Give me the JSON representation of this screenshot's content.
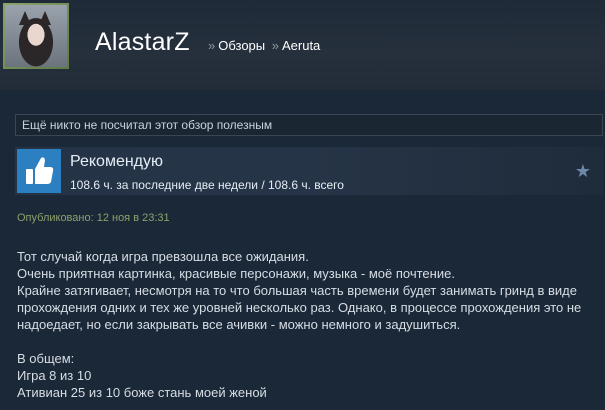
{
  "header": {
    "profile_name": "AlastarZ",
    "breadcrumb_sep": "»",
    "breadcrumb": [
      "Обзоры",
      "Aeruta"
    ]
  },
  "review": {
    "helpful_text": "Ещё никто не посчитал этот обзор полезным",
    "recommendation": "Рекомендую",
    "hours": "108.6 ч. за последние две недели / 108.6 ч. всего",
    "posted": "Опубликовано: 12 ноя в 23:31",
    "body_lines": [
      "Тот случай когда игра превзошла все ожидания.",
      "Очень приятная картинка, красивые персонажи, музыка - моё почтение.",
      "Крайне затягивает, несмотря на то что большая часть времени будет занимать гринд в виде",
      "прохождения одних и тех же уровней несколько раз. Однако, в процессе прохождения это не",
      "надоедает, но если закрывать все ачивки - можно немного и задушиться.",
      "",
      "В общем:",
      "Игра 8 из 10",
      "Ативиан 25 из 10 боже стань моей женой"
    ]
  },
  "colors": {
    "background": "#1b2838",
    "thumb_bg": "#2c7fc1",
    "posted_text": "#8ea06a"
  },
  "icons": {
    "thumb": "thumbs-up-icon",
    "star": "star-icon"
  }
}
